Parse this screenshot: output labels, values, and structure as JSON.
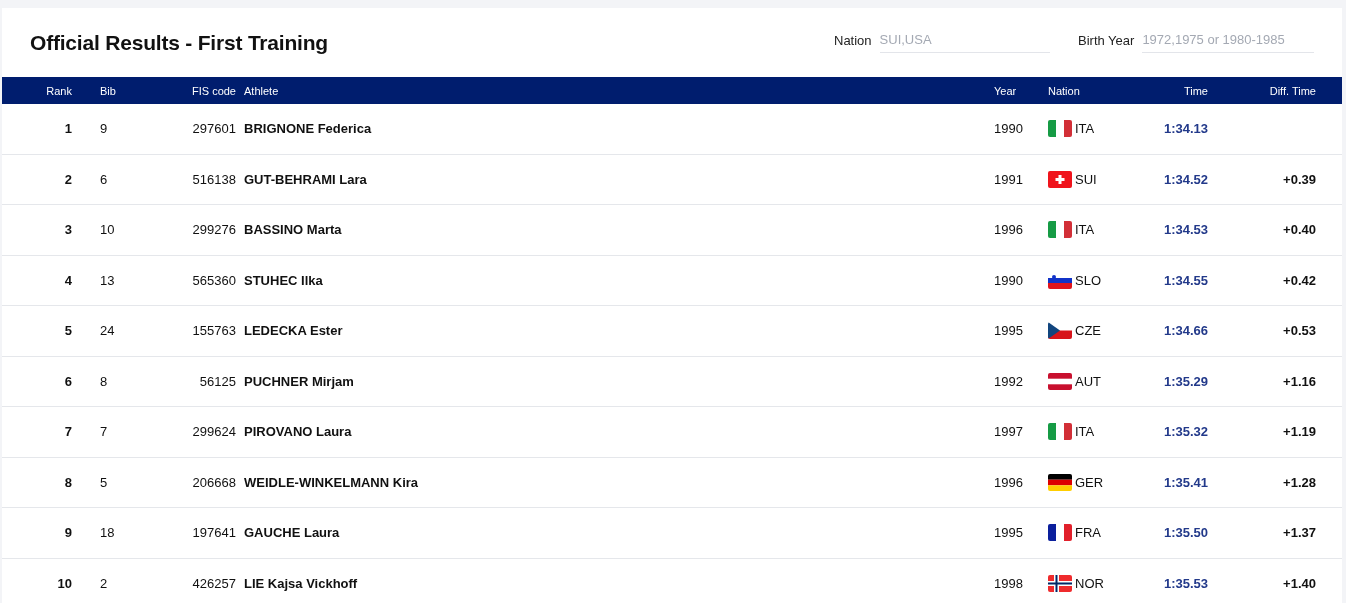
{
  "title": "Official Results - First Training",
  "filters": [
    {
      "label": "Nation",
      "placeholder": "SUI,USA"
    },
    {
      "label": "Birth Year",
      "placeholder": "1972,1975 or 1980-1985"
    }
  ],
  "table": {
    "columns": [
      "Rank",
      "Bib",
      "FIS code",
      "Athlete",
      "Year",
      "Nation",
      "Time",
      "Diff. Time"
    ],
    "rows": [
      {
        "rank": "1",
        "bib": "9",
        "fis_code": "297601",
        "athlete": "BRIGNONE Federica",
        "year": "1990",
        "flag": {
          "kind": "ita"
        },
        "nation": "ITA",
        "time": "1:34.13"
      },
      {
        "rank": "2",
        "bib": "6",
        "fis_code": "516138",
        "athlete": "GUT-BEHRAMI Lara",
        "year": "1991",
        "flag": {
          "kind": "sui"
        },
        "nation": "SUI",
        "time": "1:34.52",
        "diff": "+0.39"
      },
      {
        "rank": "3",
        "bib": "10",
        "fis_code": "299276",
        "athlete": "BASSINO Marta",
        "year": "1996",
        "flag": {
          "kind": "ita"
        },
        "nation": "ITA",
        "time": "1:34.53",
        "diff": "+0.40"
      },
      {
        "rank": "4",
        "bib": "13",
        "fis_code": "565360",
        "athlete": "STUHEC Ilka",
        "year": "1990",
        "flag": {
          "kind": "slo"
        },
        "nation": "SLO",
        "time": "1:34.55",
        "diff": "+0.42"
      },
      {
        "rank": "5",
        "bib": "24",
        "fis_code": "155763",
        "athlete": "LEDECKA Ester",
        "year": "1995",
        "flag": {
          "kind": "cze"
        },
        "nation": "CZE",
        "time": "1:34.66",
        "diff": "+0.53"
      },
      {
        "rank": "6",
        "bib": "8",
        "fis_code": "56125",
        "athlete": "PUCHNER Mirjam",
        "year": "1992",
        "flag": {
          "kind": "aut"
        },
        "nation": "AUT",
        "time": "1:35.29",
        "diff": "+1.16"
      },
      {
        "rank": "7",
        "bib": "7",
        "fis_code": "299624",
        "athlete": "PIROVANO Laura",
        "year": "1997",
        "flag": {
          "kind": "ita"
        },
        "nation": "ITA",
        "time": "1:35.32",
        "diff": "+1.19"
      },
      {
        "rank": "8",
        "bib": "5",
        "fis_code": "206668",
        "athlete": "WEIDLE-WINKELMANN Kira",
        "year": "1996",
        "flag": {
          "kind": "ger"
        },
        "nation": "GER",
        "time": "1:35.41",
        "diff": "+1.28"
      },
      {
        "rank": "9",
        "bib": "18",
        "fis_code": "197641",
        "athlete": "GAUCHE Laura",
        "year": "1995",
        "flag": {
          "kind": "fra"
        },
        "nation": "FRA",
        "time": "1:35.50",
        "diff": "+1.37"
      },
      {
        "rank": "10",
        "bib": "2",
        "fis_code": "426257",
        "athlete": "LIE Kajsa Vickhoff",
        "year": "1998",
        "flag": {
          "kind": "nor"
        },
        "nation": "NOR",
        "time": "1:35.53",
        "diff": "+1.40"
      }
    ]
  }
}
